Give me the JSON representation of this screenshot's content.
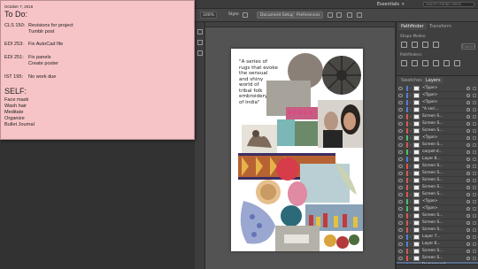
{
  "app": {
    "workspace": "Essentials",
    "search_placeholder": "Search Adobe Stock",
    "menu_dropdown": "▾"
  },
  "controlbar": {
    "zoom": "100%",
    "style_label": "Style:",
    "document_setup": "Document Setup",
    "preferences": "Preferences"
  },
  "sticky": {
    "date": "October 7, 2016",
    "todo_heading": "To Do:",
    "tasks": [
      {
        "code": "CLS 150:",
        "task": "Revisions for project"
      },
      {
        "code": "",
        "task": "Tumblr post"
      },
      {
        "code": "EDI 253:",
        "task": "Fix AutoCad file"
      },
      {
        "code": "EDI 251:",
        "task": "Fix panels"
      },
      {
        "code": "",
        "task": "Create poster"
      },
      {
        "code": "IST 195:",
        "task": "No work due"
      }
    ],
    "self_heading": "SELF:",
    "self_items": [
      "Face mask",
      "Wash hair",
      "Meditate",
      "Organize",
      "Bullet Journal"
    ]
  },
  "artboard": {
    "quote": "\"A series of\nrugs that evoke\nthe sensual\nand shiny\nworld of\ntribal folk\nembroidery\nof India\""
  },
  "panels": {
    "pathfinder_tab": "Pathfinder",
    "transform_tab": "Transform",
    "shape_modes_label": "Shape Modes:",
    "pathfinders_label": "Pathfinders:",
    "expand_label": "Expand",
    "swatches_tab": "Swatches",
    "layers_tab": "Layers"
  },
  "layers": [
    {
      "name": "<Type>",
      "color": "#4f7fd8"
    },
    {
      "name": "<Type>",
      "color": "#4f7fd8"
    },
    {
      "name": "<Type>",
      "color": "#4f7fd8"
    },
    {
      "name": "\"A seri...",
      "color": "#4f7fd8"
    },
    {
      "name": "Screen S...",
      "color": "#d8584f"
    },
    {
      "name": "Screen S...",
      "color": "#d8584f"
    },
    {
      "name": "Screen S...",
      "color": "#d8584f"
    },
    {
      "name": "<Type>",
      "color": "#4fbd6a"
    },
    {
      "name": "Screen S...",
      "color": "#d8584f"
    },
    {
      "name": "carpet-d...",
      "color": "#4fbd6a"
    },
    {
      "name": "Layer 8...",
      "color": "#4f7fd8"
    },
    {
      "name": "Screen S...",
      "color": "#d8584f"
    },
    {
      "name": "Screen S...",
      "color": "#d8584f"
    },
    {
      "name": "Screen S...",
      "color": "#d8584f"
    },
    {
      "name": "Screen S...",
      "color": "#d8584f"
    },
    {
      "name": "Screen S...",
      "color": "#d8584f"
    },
    {
      "name": "<Type>",
      "color": "#4fbd6a"
    },
    {
      "name": "<Type>",
      "color": "#4fbd6a"
    },
    {
      "name": "Screen S...",
      "color": "#d8584f"
    },
    {
      "name": "Screen S...",
      "color": "#d8584f"
    },
    {
      "name": "Screen S...",
      "color": "#d8584f"
    },
    {
      "name": "Layer 7...",
      "color": "#4f7fd8"
    },
    {
      "name": "Layer 6...",
      "color": "#4f7fd8"
    },
    {
      "name": "Screen S...",
      "color": "#d8584f"
    },
    {
      "name": "Screen S...",
      "color": "#d8584f"
    },
    {
      "name": "Background",
      "color": "#4f7fd8"
    }
  ]
}
